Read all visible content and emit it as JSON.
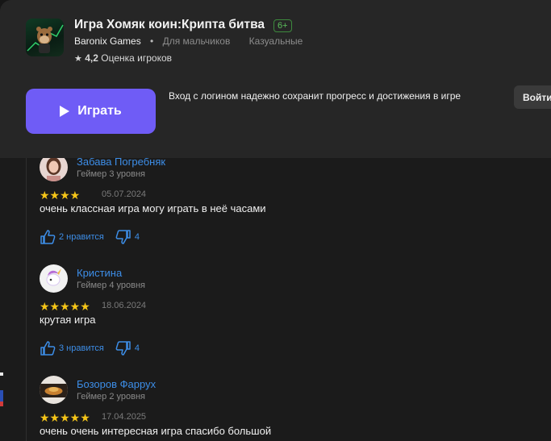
{
  "game": {
    "title": "Игра Хомяк коин:Крипта битва",
    "age": "6+",
    "developer": "Baronix Games",
    "tags": [
      "Для мальчиков",
      "Казуальные"
    ],
    "rating": "4,2",
    "rating_label": "Оценка игроков"
  },
  "actions": {
    "play_label": "Играть",
    "login_hint": "Вход с логином надежно сохранит прогресс и достижения в игре",
    "login_button": "Войти"
  },
  "colors": {
    "accent": "#6f5cf6",
    "link": "#3d8ee8",
    "star": "#f5c518",
    "age_badge": "#5bbf5b"
  },
  "reviews": [
    {
      "name": "Забава Погребняк",
      "level": "Геймер 3 уровня",
      "stars": "★★★★",
      "rating": 4,
      "date": "05.07.2024",
      "text": "очень классная игра могу играть в неё часами",
      "likes": "2 нравится",
      "dislikes": "4"
    },
    {
      "name": "Кристина",
      "level": "Геймер 4 уровня",
      "stars": "★★★★★",
      "rating": 5,
      "date": "18.06.2024",
      "text": "крутая  игра",
      "likes": "3 нравится",
      "dislikes": "4"
    },
    {
      "name": "Бозоров Фаррух",
      "level": "Геймер 2 уровня",
      "stars": "★★★★★",
      "rating": 5,
      "date": "17.04.2025",
      "text": "очень очень интересная игра  спасибо большой"
    }
  ]
}
